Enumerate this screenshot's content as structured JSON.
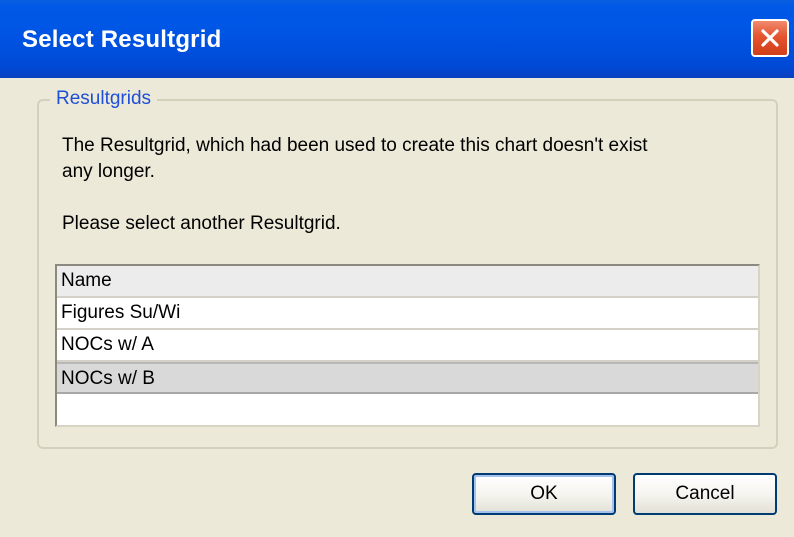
{
  "window": {
    "title": "Select Resultgrid"
  },
  "group": {
    "legend": "Resultgrids"
  },
  "message": {
    "line1": "The Resultgrid, which had been used to create this chart doesn't exist",
    "line2": "any longer.",
    "line3": "Please select another Resultgrid."
  },
  "list": {
    "header": "Name",
    "items": [
      {
        "label": "Figures Su/Wi",
        "selected": false
      },
      {
        "label": "NOCs w/ A",
        "selected": false
      },
      {
        "label": "NOCs w/ B",
        "selected": true
      }
    ]
  },
  "buttons": {
    "ok_label": "OK",
    "cancel_label": "Cancel"
  },
  "colors": {
    "titlebar": "#0055e5",
    "close_button": "#e5532f",
    "legend_text": "#1f4fd6",
    "dialog_background": "#ece9d8"
  },
  "icons": {
    "close": "close-icon"
  }
}
